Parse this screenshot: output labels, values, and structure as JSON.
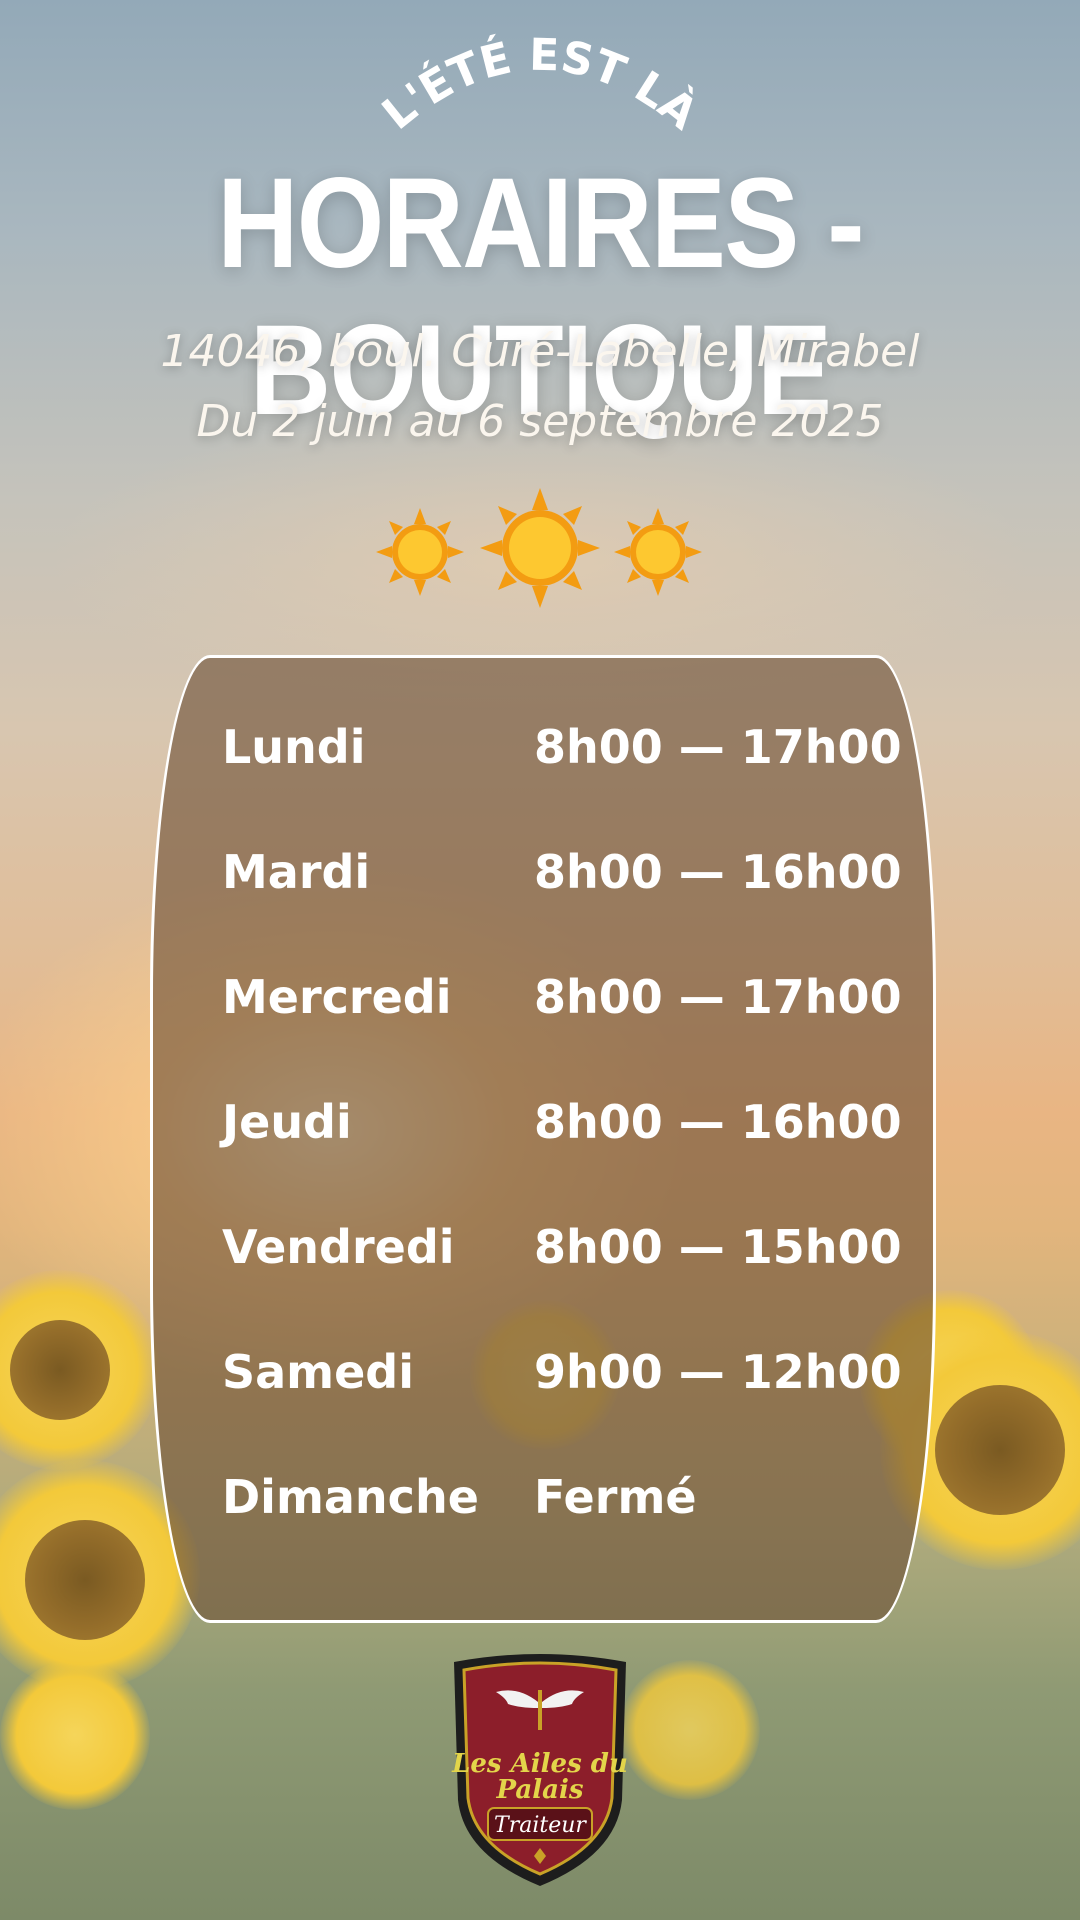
{
  "header": {
    "kicker": "L'ÉTÉ EST LÀ",
    "title": "HORAIRES - BOUTIQUE",
    "address": "14046, boul. Curé-Labelle, Mirabel",
    "dates": "Du 2 juin au 6 septembre 2025"
  },
  "schedule": [
    {
      "day": "Lundi",
      "hours": "8h00 — 17h00"
    },
    {
      "day": "Mardi",
      "hours": "8h00 — 16h00"
    },
    {
      "day": "Mercredi",
      "hours": "8h00 — 17h00"
    },
    {
      "day": "Jeudi",
      "hours": "8h00 — 16h00"
    },
    {
      "day": "Vendredi",
      "hours": "8h00 — 15h00"
    },
    {
      "day": "Samedi",
      "hours": "9h00 — 12h00"
    },
    {
      "day": "Dimanche",
      "hours": "Fermé"
    }
  ],
  "logo": {
    "line1": "Les Ailes du",
    "line2": "Palais",
    "line3": "Traiteur"
  },
  "colors": {
    "panel": "#6e5037",
    "shield": "#8c1e2a",
    "logo_text": "#e3d54a",
    "sun": "#f7b21b"
  },
  "icons": [
    "sun-icon",
    "wings-icon"
  ]
}
